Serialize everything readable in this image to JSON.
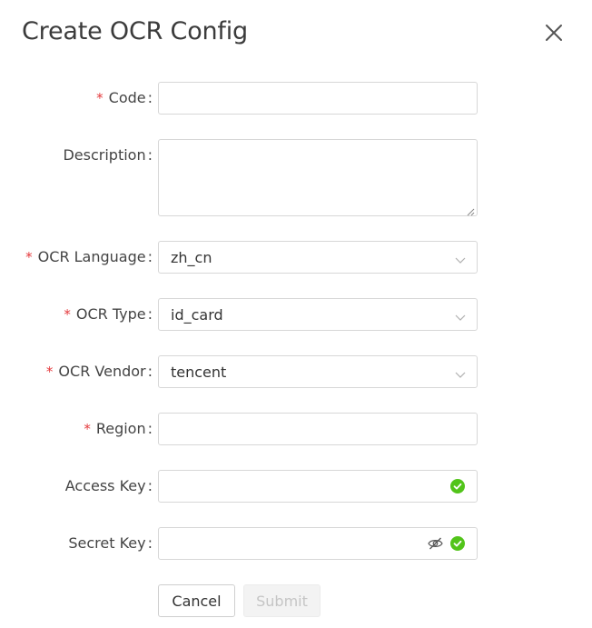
{
  "dialog": {
    "title": "Create OCR Config",
    "close_icon": "close-icon"
  },
  "form": {
    "required_mark": "*",
    "colon": ":",
    "code": {
      "label": "Code",
      "required": true,
      "value": ""
    },
    "description": {
      "label": "Description",
      "required": false,
      "value": ""
    },
    "ocr_language": {
      "label": "OCR Language",
      "required": true,
      "value": "zh_cn"
    },
    "ocr_type": {
      "label": "OCR Type",
      "required": true,
      "value": "id_card"
    },
    "ocr_vendor": {
      "label": "OCR Vendor",
      "required": true,
      "value": "tencent"
    },
    "region": {
      "label": "Region",
      "required": true,
      "value": ""
    },
    "access_key": {
      "label": "Access Key",
      "required": false,
      "value": "",
      "status_icon": "check-circle-icon"
    },
    "secret_key": {
      "label": "Secret Key",
      "required": false,
      "value": "",
      "visibility_icon": "eye-off-icon",
      "status_icon": "check-circle-icon"
    }
  },
  "buttons": {
    "cancel": "Cancel",
    "submit": "Submit"
  },
  "colors": {
    "required": "#e4393c",
    "success": "#52c41a",
    "border": "#d7d7d7",
    "disabled_text": "#c5c5c5"
  }
}
